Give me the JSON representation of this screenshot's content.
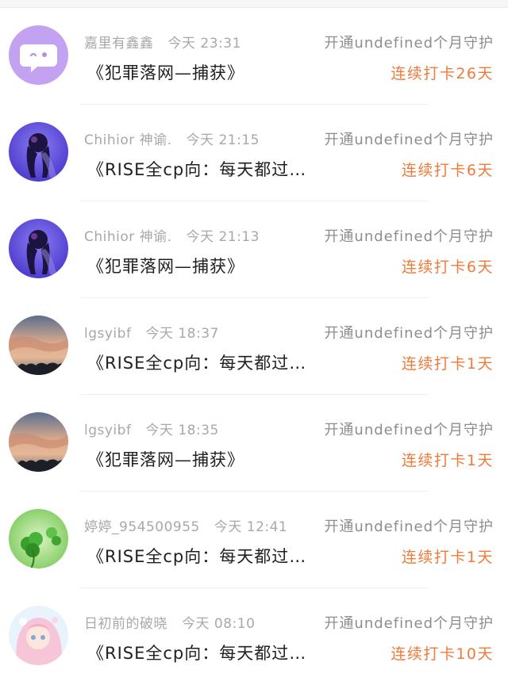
{
  "colors": {
    "accent_orange": "#f07a3a",
    "meta_gray": "#a8a8a8",
    "action_gray": "#8d8d8d",
    "title_black": "#202020"
  },
  "rows": [
    {
      "avatar_icon": "purple-chat-bubble-avatar",
      "user": "嘉里有鑫鑫",
      "time": "今天 23:31",
      "title": "《犯罪落网—捕获》",
      "action": "开通undefined个月守护",
      "streak": "连续打卡26天"
    },
    {
      "avatar_icon": "purple-silhouette-avatar",
      "user": "Chihior 神谕.",
      "time": "今天 21:15",
      "title": "《RISE全cp向：每天都过…",
      "action": "开通undefined个月守护",
      "streak": "连续打卡6天"
    },
    {
      "avatar_icon": "purple-silhouette-avatar",
      "user": "Chihior 神谕.",
      "time": "今天 21:13",
      "title": "《犯罪落网—捕获》",
      "action": "开通undefined个月守护",
      "streak": "连续打卡6天"
    },
    {
      "avatar_icon": "sunset-sky-avatar",
      "user": "lgsyibf",
      "time": "今天 18:37",
      "title": "《RISE全cp向：每天都过…",
      "action": "开通undefined个月守护",
      "streak": "连续打卡1天"
    },
    {
      "avatar_icon": "sunset-sky-avatar",
      "user": "lgsyibf",
      "time": "今天 18:35",
      "title": "《犯罪落网—捕获》",
      "action": "开通undefined个月守护",
      "streak": "连续打卡1天"
    },
    {
      "avatar_icon": "green-clover-avatar",
      "user": "婷婷_954500955",
      "time": "今天 12:41",
      "title": "《RISE全cp向：每天都过…",
      "action": "开通undefined个月守护",
      "streak": "连续打卡1天"
    },
    {
      "avatar_icon": "anime-girl-avatar",
      "user": "日初前的破晓",
      "time": "今天 08:10",
      "title": "《RISE全cp向：每天都过…",
      "action": "开通undefined个月守护",
      "streak": "连续打卡10天"
    }
  ]
}
